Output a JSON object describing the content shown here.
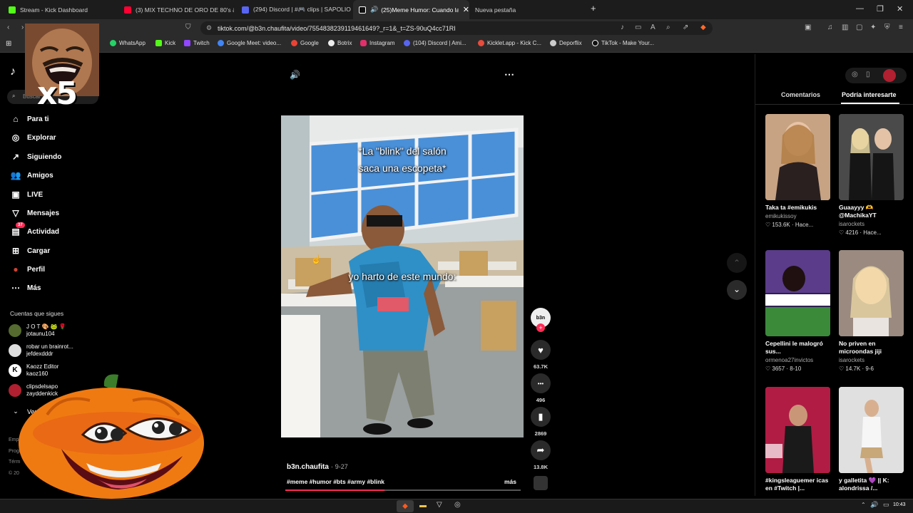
{
  "tabs": [
    {
      "label": "Stream - Kick Dashboard",
      "color": "#53fc18"
    },
    {
      "label": "(3) MIX TECHNO DE ORO DE 80's & 90's",
      "color": "#ff0033"
    },
    {
      "label": "(294) Discord | #🎮 clips | SAPOLIO",
      "color": "#5865f2"
    },
    {
      "label": "(25)Meme Humor: Cuando la",
      "color": "#ffffff"
    },
    {
      "label": "Nueva pestaña",
      "color": ""
    }
  ],
  "address": {
    "url": "tiktok.com/@b3n.chaufita/video/7554838239119461649?_r=1&_t=ZS-90uQ4cc71RI"
  },
  "bookmarks": [
    {
      "label": "WhatsApp",
      "color": "#25d366"
    },
    {
      "label": "Kick",
      "color": "#53fc18"
    },
    {
      "label": "Twitch",
      "color": "#9146ff"
    },
    {
      "label": "Google Meet: video...",
      "color": "#4285f4"
    },
    {
      "label": "Google",
      "color": "#ea4335"
    },
    {
      "label": "Botrix",
      "color": "#eeeeee"
    },
    {
      "label": "Instagram",
      "color": "#e1306c"
    },
    {
      "label": "(104) Discord | Ami...",
      "color": "#5865f2"
    },
    {
      "label": "Kicklet.app - Kick C...",
      "color": "#e74c3c"
    },
    {
      "label": "Deporflix",
      "color": "#cccccc"
    },
    {
      "label": "TikTok - Make Your...",
      "color": "#ffffff"
    }
  ],
  "sidebar": {
    "search_placeholder": "Buscar",
    "nav": [
      {
        "label": "Para ti",
        "icon": "home-icon",
        "glyph": "⌂"
      },
      {
        "label": "Explorar",
        "icon": "compass-icon",
        "glyph": "◎"
      },
      {
        "label": "Siguiendo",
        "icon": "arrow-user-icon",
        "glyph": "↗"
      },
      {
        "label": "Amigos",
        "icon": "friends-icon",
        "glyph": "👥"
      },
      {
        "label": "LIVE",
        "icon": "live-icon",
        "glyph": "▣"
      },
      {
        "label": "Mensajes",
        "icon": "messages-icon",
        "glyph": "▽"
      },
      {
        "label": "Actividad",
        "icon": "activity-icon",
        "glyph": "▤"
      },
      {
        "label": "Cargar",
        "icon": "upload-icon",
        "glyph": "⊞"
      },
      {
        "label": "Perfil",
        "icon": "profile-icon",
        "glyph": "●"
      },
      {
        "label": "Más",
        "icon": "more-icon",
        "glyph": "⋯"
      }
    ],
    "activity_badge": "37",
    "following_title": "Cuentas que sigues",
    "following": [
      {
        "name": "J O T 🎨 🐸 🌹",
        "handle": "jotaunu104",
        "color": "#556b2f"
      },
      {
        "name": "robar un brainrot...",
        "handle": "jefdexdddr",
        "color": "#dddddd"
      },
      {
        "name": "Kaozz Editor",
        "handle": "kaoz160",
        "color": "#ffffff"
      },
      {
        "name": "clipsdelsapo",
        "handle": "zayddenkick",
        "color": "#b02030"
      }
    ],
    "see_more": "Ver más",
    "footer": [
      "Empres",
      "Progr",
      "Térm",
      "© 20"
    ]
  },
  "overlay": {
    "multiplier": "x5"
  },
  "video": {
    "caption_top_line1": "*La \"blink\" del salón",
    "caption_top_line2": "saca una escopeta*",
    "caption_mid": "yo harto de este mundo:",
    "author": "b3n.chaufita",
    "date": "9-27",
    "hashtags": "#meme #humor #bts #army #blink",
    "more": "más",
    "avatar_text": "b3n"
  },
  "actions": [
    {
      "icon": "heart-icon",
      "glyph": "♥",
      "count": "63.7K"
    },
    {
      "icon": "comment-icon",
      "glyph": "•••",
      "count": "496"
    },
    {
      "icon": "bookmark-icon",
      "glyph": "▮",
      "count": "2869"
    },
    {
      "icon": "share-icon",
      "glyph": "➦",
      "count": "13.8K"
    }
  ],
  "right_panel": {
    "tabs": [
      "Comentarios",
      "Podría interesarte"
    ],
    "cards": [
      {
        "title": "Taka ta #emikukis",
        "user": "emikukissoy",
        "stats": "♡ 153.6K · Hace...",
        "color": "#a87a5a"
      },
      {
        "title": "Guaayyy 🫶 @MachikaYT",
        "user": "isarockets",
        "stats": "♡ 4216 · Hace...",
        "color": "#3a3a3a"
      },
      {
        "title": "Cepellini le malogró sus...",
        "user": "ormenoa27invictos",
        "stats": "♡ 3657 · 8-10",
        "color": "#3d2a6a"
      },
      {
        "title": "No priven en microondas jiji",
        "user": "isarockets",
        "stats": "♡ 14.7K · 9-6",
        "color": "#b58f80"
      },
      {
        "title": "#kingsleaguemer icas en #Twitch |...",
        "user": "",
        "stats": "",
        "color": "#c0214a"
      },
      {
        "title": "y galletita 💜 || K: alondrissa /...",
        "user": "",
        "stats": "",
        "color": "#d9d9d9"
      }
    ]
  },
  "clock": {
    "time": "10:43"
  }
}
